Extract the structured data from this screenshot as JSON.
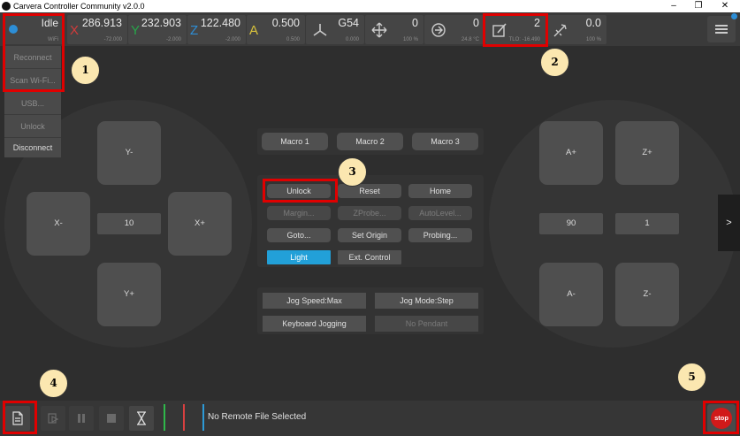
{
  "window": {
    "title": "Carvera Controller Community v2.0.0",
    "min_glyph": "–",
    "max_glyph": "❐",
    "close_glyph": "✕"
  },
  "status": {
    "state": "Idle",
    "conn": "WiFi"
  },
  "axes": {
    "x": {
      "label": "X",
      "value": "286.913",
      "sub": "-72.000",
      "color": "#d23b3b"
    },
    "y": {
      "label": "Y",
      "value": "232.903",
      "sub": "-2.000",
      "color": "#27a64a"
    },
    "z": {
      "label": "Z",
      "value": "122.480",
      "sub": "-2.000",
      "color": "#2d8ed6"
    },
    "a": {
      "label": "A",
      "value": "0.500",
      "sub": "0.500",
      "color": "#d8c23c"
    }
  },
  "topbar": {
    "wcs": {
      "value": "G54",
      "sub": "0.000"
    },
    "feed": {
      "value": "0",
      "sub": "100 %"
    },
    "spindle": {
      "value": "0",
      "sub": "24.8 °C"
    },
    "tool": {
      "value": "2",
      "sub": "TLO: -16.490"
    },
    "laser": {
      "value": "0.0",
      "sub": "100 %"
    }
  },
  "conn_menu": {
    "items": [
      "Reconnect",
      "Scan Wi-Fi...",
      "USB...",
      "Unlock",
      "Disconnect"
    ]
  },
  "jog_left": {
    "yminus": "Y-",
    "yplus": "Y+",
    "xminus": "X-",
    "xplus": "X+",
    "step": "10"
  },
  "jog_right": {
    "aplus": "A+",
    "zplus": "Z+",
    "aminus": "A-",
    "zminus": "Z-",
    "a_step": "90",
    "z_step": "1"
  },
  "macros": [
    "Macro 1",
    "Macro 2",
    "Macro 3"
  ],
  "controls": {
    "unlock": "Unlock",
    "reset": "Reset",
    "home": "Home",
    "margin": "Margin...",
    "zprobe": "ZProbe...",
    "autolevel": "AutoLevel...",
    "goto": "Goto...",
    "set_origin": "Set Origin",
    "probing": "Probing...",
    "light": "Light",
    "ext_control": "Ext. Control"
  },
  "jog_settings": {
    "speed": "Jog Speed:Max",
    "mode": "Jog Mode:Step",
    "keyboard": "Keyboard Jogging",
    "pendant": "No Pendant"
  },
  "side_tab": ">",
  "bottom": {
    "file": "No Remote File Selected",
    "stop": "stop"
  },
  "annotations": [
    "1",
    "2",
    "3",
    "4",
    "5"
  ],
  "colors": {
    "accent": "#22a0d8",
    "annotation": "#e00000",
    "stop": "#d11a1a"
  }
}
